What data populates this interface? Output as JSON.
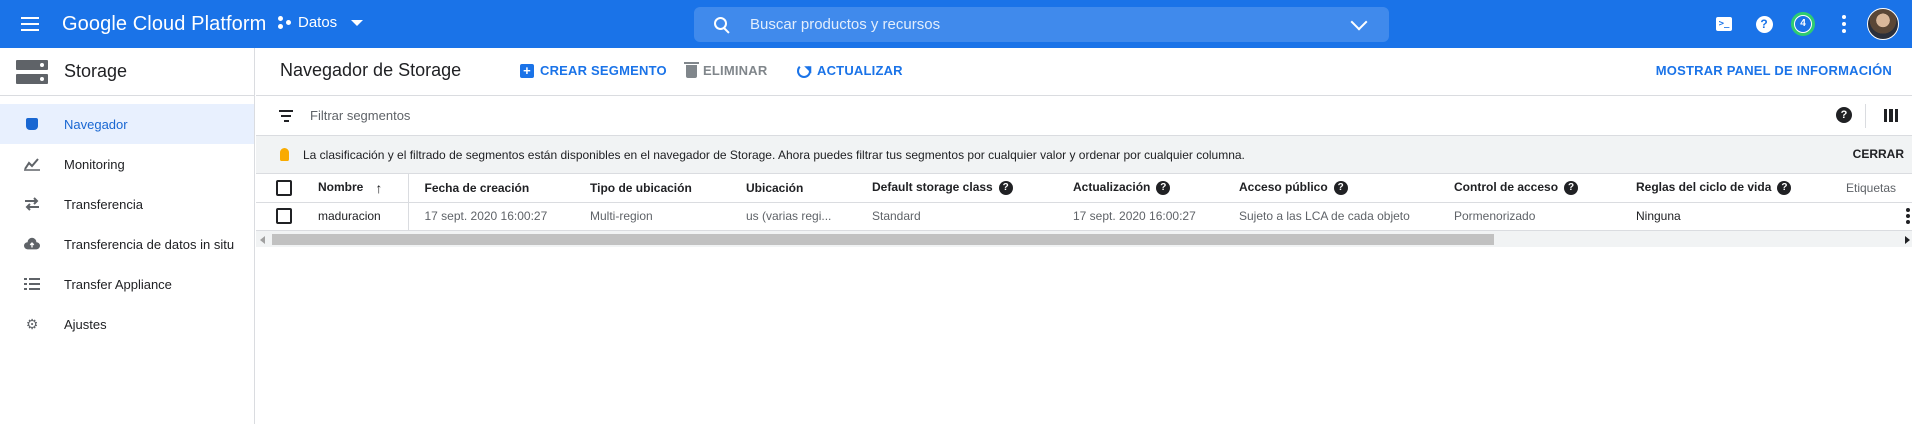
{
  "topbar": {
    "brand": "Google Cloud Platform",
    "project": "Datos",
    "search_placeholder": "Buscar productos y recursos",
    "notification_count": "4",
    "accent": "#1a73e8"
  },
  "sidebar": {
    "title": "Storage",
    "items": [
      {
        "label": "Navegador",
        "icon": "bucket-icon"
      },
      {
        "label": "Monitoring",
        "icon": "chart-icon"
      },
      {
        "label": "Transferencia",
        "icon": "swap-icon"
      },
      {
        "label": "Transferencia de datos in situ",
        "icon": "cloud-upload-icon"
      },
      {
        "label": "Transfer Appliance",
        "icon": "list-icon"
      },
      {
        "label": "Ajustes",
        "icon": "gear-icon"
      }
    ]
  },
  "main": {
    "title": "Navegador de Storage",
    "actions": {
      "create": "CREAR SEGMENTO",
      "delete": "ELIMINAR",
      "refresh": "ACTUALIZAR",
      "info_panel": "MOSTRAR PANEL DE INFORMACIÓN"
    },
    "filter_placeholder": "Filtrar segmentos",
    "banner": {
      "text": "La clasificación y el filtrado de segmentos están disponibles en el navegador de Storage. Ahora puedes filtrar tus segmentos por cualquier valor y ordenar por cualquier columna.",
      "close": "CERRAR"
    },
    "table": {
      "columns": [
        "Nombre",
        "Fecha de creación",
        "Tipo de ubicación",
        "Ubicación",
        "Default storage class",
        "Actualización",
        "Acceso público",
        "Control de acceso",
        "Reglas del ciclo de vida",
        "Etiquetas"
      ],
      "rows": [
        [
          "maduracion",
          "17 sept. 2020 16:00:27",
          "Multi-region",
          "us (varias regi...",
          "Standard",
          "17 sept. 2020 16:00:27",
          "Sujeto a las LCA de cada objeto",
          "Pormenorizado",
          "Ninguna",
          ""
        ]
      ]
    }
  }
}
